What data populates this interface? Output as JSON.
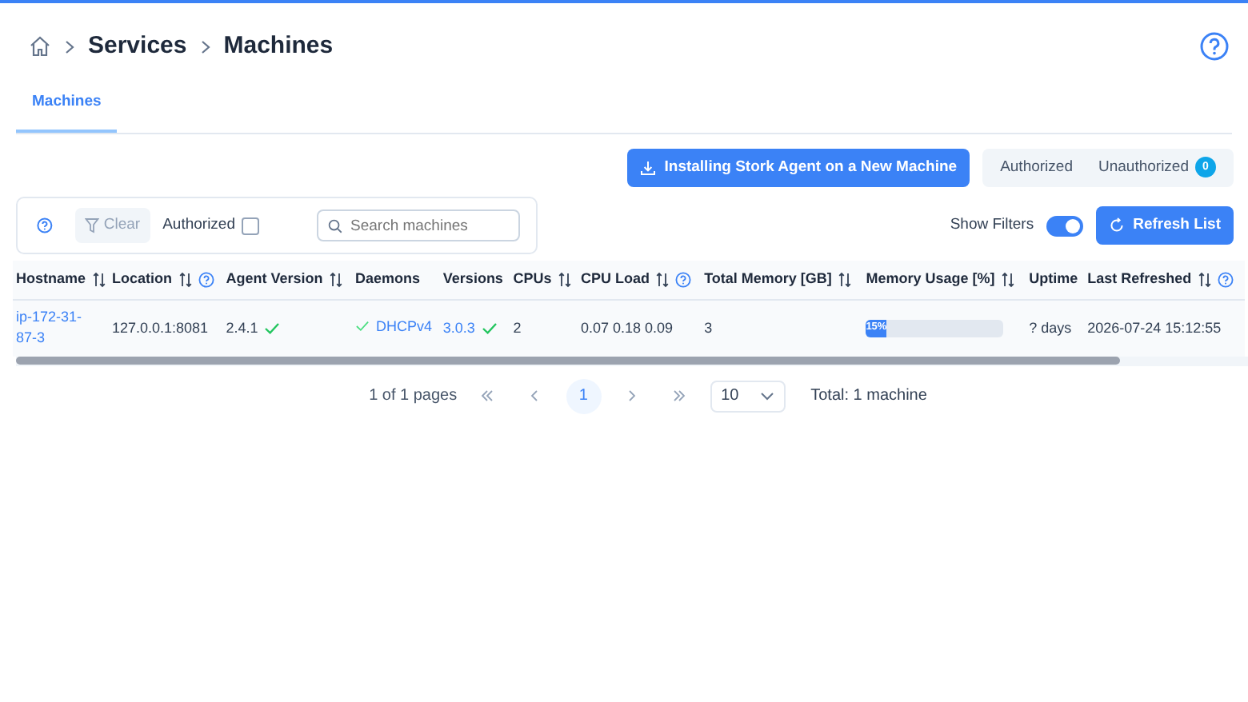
{
  "breadcrumb": [
    "Services",
    "Machines"
  ],
  "tabs": [
    {
      "label": "Machines",
      "selected": true
    }
  ],
  "install_button": "Installing Stork Agent on a New Machine",
  "auth_toggle": [
    {
      "label": "Authorized",
      "selected": false
    },
    {
      "label": "Unauthorized",
      "selected": false,
      "badge": "0"
    }
  ],
  "filters": {
    "clear": {
      "label": "Clear",
      "disabled": true
    },
    "authorized": {
      "label": "Authorized",
      "checked": false
    },
    "search": {
      "placeholder": "Search machines"
    }
  },
  "show_filters": {
    "label": "Show Filters",
    "on": true
  },
  "refresh_button": "Refresh List",
  "table": {
    "columns": [
      {
        "label": "Hostname",
        "sortable": true
      },
      {
        "label": "Location",
        "sortable": true,
        "help": true
      },
      {
        "label": "Agent Version",
        "sortable": true
      },
      {
        "label": "Daemons",
        "sortable": false
      },
      {
        "label": "Versions",
        "sortable": false
      },
      {
        "label": "CPUs",
        "sortable": true
      },
      {
        "label": "CPU Load",
        "sortable": true,
        "help": true
      },
      {
        "label": "Total Memory [GB]",
        "sortable": true
      },
      {
        "label": "Memory Usage [%]",
        "sortable": true
      },
      {
        "label": "Uptime",
        "sortable": false
      },
      {
        "label": "Last Refreshed",
        "sortable": true,
        "help": true
      }
    ],
    "rows": [
      {
        "hostname": "ip-172-31-87-3",
        "location": "127.0.0.1:8081",
        "agent_version": "2.4.1",
        "daemons": "DHCPv4",
        "versions": "3.0.3",
        "cpus": "2",
        "cpu_load": "0.07 0.18 0.09",
        "total_memory": "3",
        "memory_usage": {
          "label": "15%",
          "level": 0.15
        },
        "uptime": "? days",
        "last_refreshed": "2026-07-24 15:12:55"
      }
    ]
  },
  "paginator": {
    "summary": "1 of 1 pages",
    "pages": [
      {
        "label": "1",
        "selected": true
      }
    ],
    "rows_per_page": "10",
    "total": "Total: 1 machine"
  }
}
